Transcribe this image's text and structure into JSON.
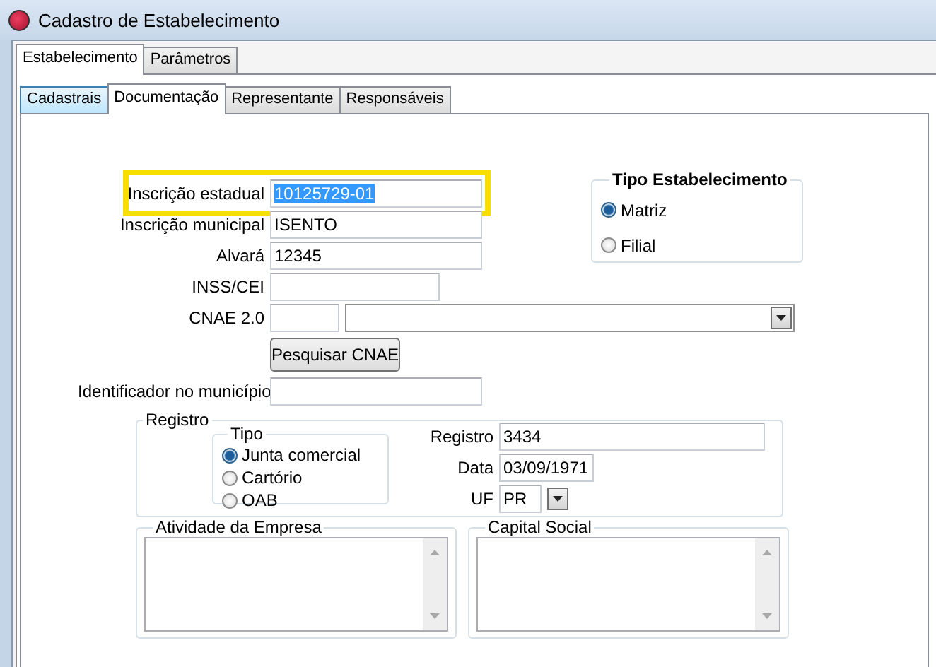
{
  "window": {
    "title": "Cadastro de Estabelecimento"
  },
  "outer_tabs": [
    {
      "label": "Estabelecimento",
      "selected": true
    },
    {
      "label": "Parâmetros",
      "selected": false
    }
  ],
  "inner_tabs": [
    {
      "label": "Cadastrais",
      "selected": false,
      "hovered": true
    },
    {
      "label": "Documentação",
      "selected": true,
      "hovered": false
    },
    {
      "label": "Representante",
      "selected": false,
      "hovered": false
    },
    {
      "label": "Responsáveis",
      "selected": false,
      "hovered": false
    }
  ],
  "fields": [
    {
      "kind": "text",
      "label": "Inscrição estadual",
      "value": "10125729-01",
      "highlighted": true,
      "text_selected": true
    },
    {
      "kind": "text",
      "label": "Inscrição municipal",
      "value": "ISENTO",
      "highlighted": false,
      "text_selected": false
    },
    {
      "kind": "text",
      "label": "Alvará",
      "value": "12345",
      "highlighted": false,
      "text_selected": false
    },
    {
      "kind": "short",
      "label": "INSS/CEI",
      "highlighted": false
    },
    {
      "kind": "cnae",
      "label": "CNAE 2.0",
      "highlighted": false
    },
    {
      "kind": "button",
      "label": "Pesquisar CNAE"
    },
    {
      "kind": "text",
      "label": "Identificador no município",
      "highlighted": false
    }
  ],
  "establishment_type": {
    "title": "Tipo Estabelecimento",
    "options": [
      {
        "label": "Matriz",
        "selected": true
      },
      {
        "label": "Filial",
        "selected": false
      }
    ]
  },
  "registro": {
    "title": "Registro",
    "tipo": {
      "title": "Tipo",
      "options": [
        {
          "label": "Junta comercial",
          "selected": true
        },
        {
          "label": "Cartório",
          "selected": false
        },
        {
          "label": "OAB",
          "selected": false
        }
      ]
    },
    "fields": [
      {
        "kind": "text",
        "label": "Registro",
        "value": "3434"
      },
      {
        "kind": "date",
        "label": "Data",
        "value": "03/09/1971"
      },
      {
        "kind": "combo",
        "label": "UF",
        "value": "PR"
      }
    ]
  },
  "memos": [
    {
      "title": "Atividade da Empresa"
    },
    {
      "title": "Capital Social"
    }
  ]
}
